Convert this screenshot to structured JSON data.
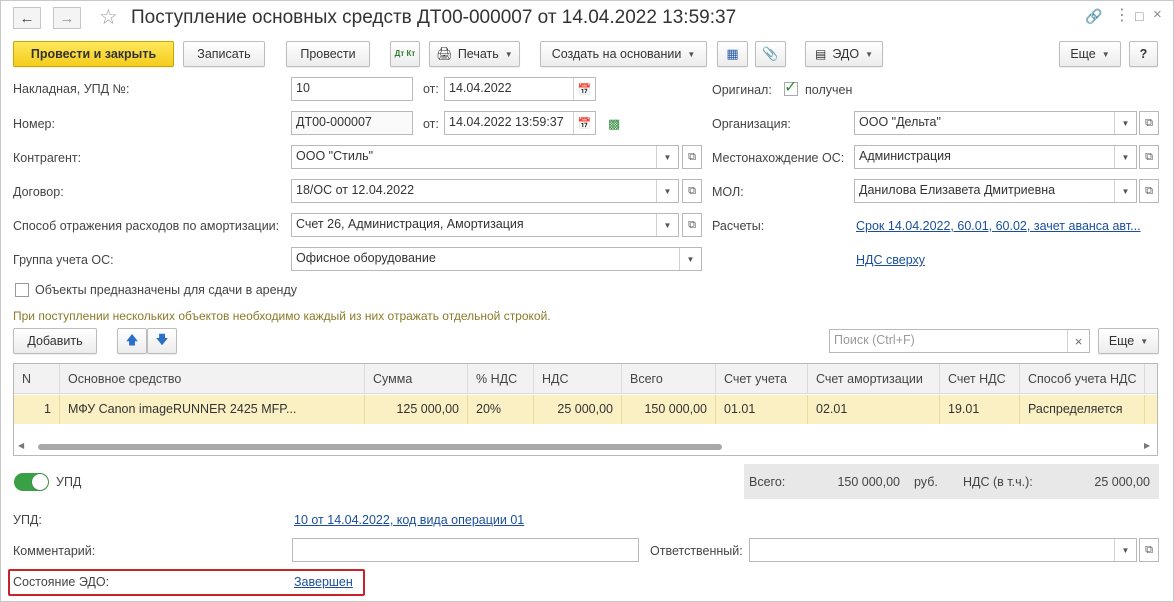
{
  "window": {
    "title": "Поступление основных средств ДТ00-000007 от 14.04.2022 13:59:37"
  },
  "toolbar": {
    "post_close": "Провести и закрыть",
    "save": "Записать",
    "post": "Провести",
    "dt_kt": "Дт Кт",
    "print": "Печать",
    "create_based": "Создать на основании",
    "edo": "ЭДО",
    "more": "Еще",
    "help": "?"
  },
  "form": {
    "invoice": {
      "label": "Накладная, УПД №:",
      "value": "10",
      "date_label": "от:",
      "date": "14.04.2022"
    },
    "number": {
      "label": "Номер:",
      "value": "ДТ00-000007",
      "date_label": "от:",
      "date": "14.04.2022 13:59:37"
    },
    "contractor": {
      "label": "Контрагент:",
      "value": "ООО \"Стиль\""
    },
    "contract": {
      "label": "Договор:",
      "value": "18/ОС от 12.04.2022"
    },
    "expense_method": {
      "label": "Способ отражения расходов по амортизации:",
      "value": "Счет 26, Администрация, Амортизация"
    },
    "asset_group": {
      "label": "Группа учета ОС:",
      "value": "Офисное оборудование"
    },
    "rent_checkbox": {
      "label": "Объекты предназначены для сдачи в аренду",
      "checked": false
    },
    "hint": "При поступлении нескольких объектов необходимо каждый из них отражать отдельной строкой.",
    "original": {
      "label": "Оригинал:",
      "value": "получен",
      "checked": true
    },
    "organization": {
      "label": "Организация:",
      "value": "ООО \"Дельта\""
    },
    "location": {
      "label": "Местонахождение ОС:",
      "value": "Администрация"
    },
    "mol": {
      "label": "МОЛ:",
      "value": "Данилова Елизавета Дмитриевна"
    },
    "settlements": {
      "label": "Расчеты:",
      "link": "Срок 14.04.2022, 60.01, 60.02, зачет аванса авт..."
    },
    "vat_link": "НДС сверху"
  },
  "table_toolbar": {
    "add": "Добавить",
    "search_placeholder": "Поиск (Ctrl+F)",
    "clear": "×",
    "more": "Еще"
  },
  "table": {
    "columns": [
      "N",
      "Основное средство",
      "Сумма",
      "% НДС",
      "НДС",
      "Всего",
      "Счет учета",
      "Счет амортизации",
      "Счет НДС",
      "Способ учета НДС"
    ],
    "rows": [
      [
        "1",
        "МФУ Canon imageRUNNER 2425 MFP...",
        "125 000,00",
        "20%",
        "25 000,00",
        "150 000,00",
        "01.01",
        "02.01",
        "19.01",
        "Распределяется"
      ]
    ]
  },
  "totals": {
    "total_label": "Всего:",
    "total_value": "150 000,00",
    "currency": "руб.",
    "vat_label": "НДС (в т.ч.):",
    "vat_value": "25 000,00"
  },
  "upd": {
    "toggle_label": "УПД",
    "toggle_on": true,
    "label": "УПД:",
    "link": "10 от 14.04.2022, код вида операции 01"
  },
  "comment": {
    "label": "Комментарий:",
    "value": ""
  },
  "responsible": {
    "label": "Ответственный:",
    "value": ""
  },
  "edo_state": {
    "label": "Состояние ЭДО:",
    "link": "Завершен"
  },
  "colors": {
    "primary_button": "#f4cc1c",
    "selected_row": "#fbf0c4",
    "link": "#1a4e9c",
    "toggle_on": "#3aa046",
    "highlight_border": "#c8232c"
  }
}
